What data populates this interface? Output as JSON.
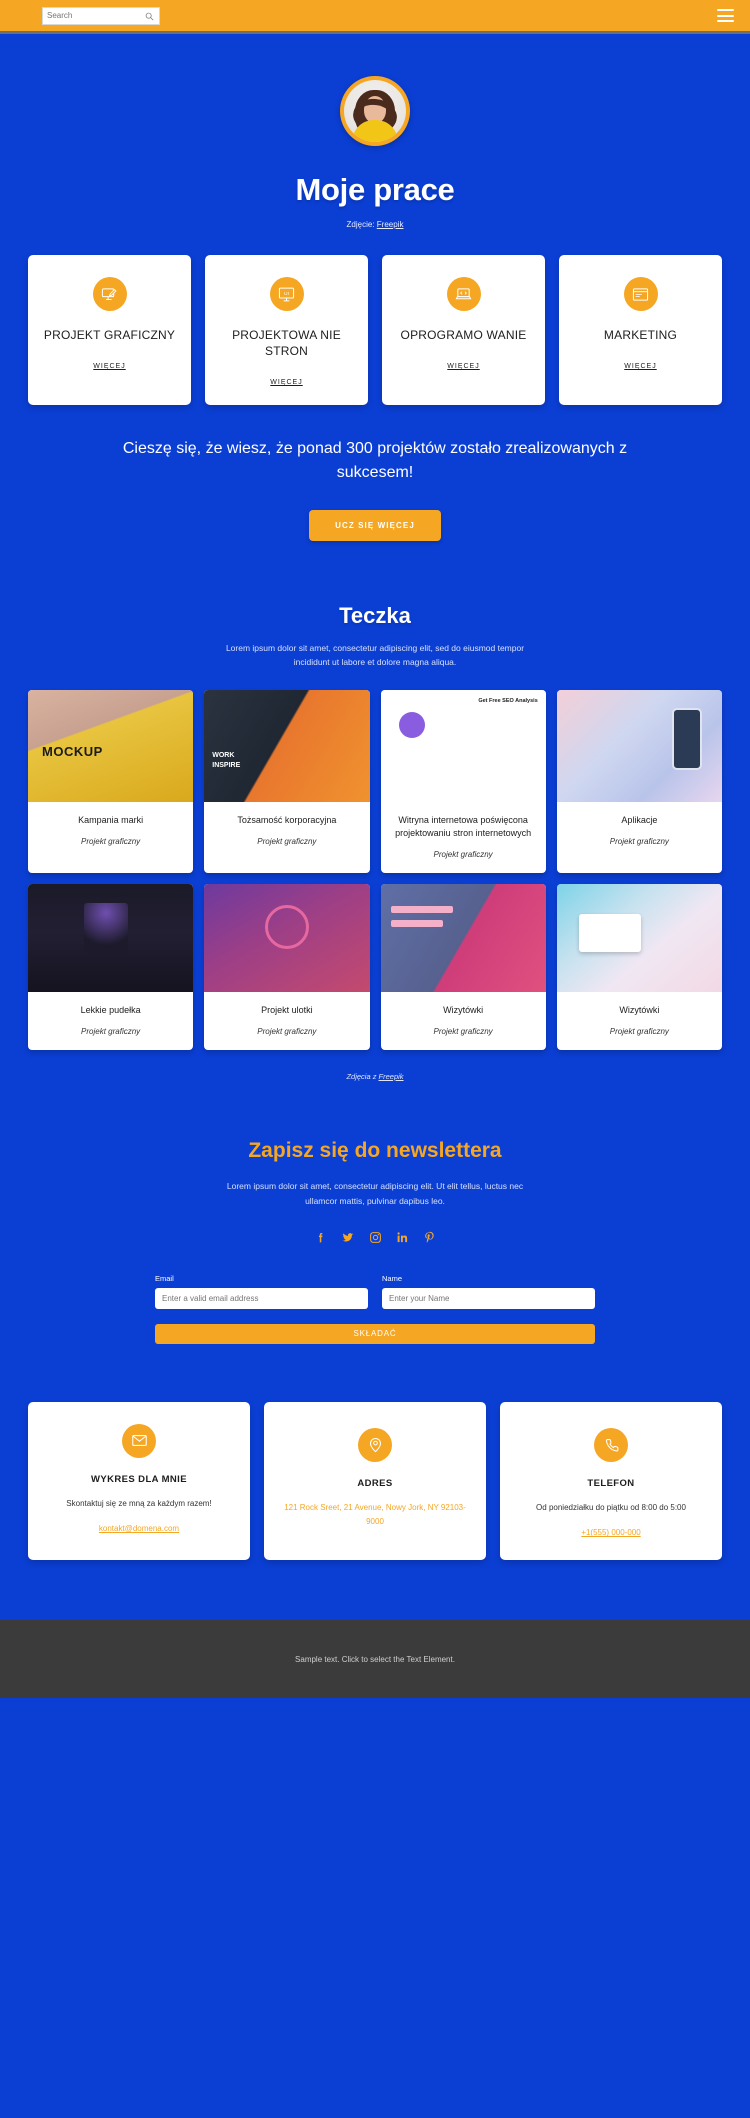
{
  "topbar": {
    "search_value": "",
    "search_placeholder": "Search",
    "search_icon": "search-icon",
    "menu_icon": "hamburger-menu-icon"
  },
  "hero": {
    "title": "Moje prace",
    "credit_prefix": "Zdjęcie: ",
    "credit_link": "Freepik",
    "avatar_alt": "portrait-photo"
  },
  "services": [
    {
      "icon": "design-tablet-brush-icon",
      "title": "PROJEKT GRAFICZNY",
      "more": "WIĘCEJ"
    },
    {
      "icon": "ui-monitor-icon",
      "title": "PROJEKTOWA NIE STRON",
      "more": "WIĘCEJ"
    },
    {
      "icon": "code-laptop-icon",
      "title": "OPROGRAMO WANIE",
      "more": "WIĘCEJ"
    },
    {
      "icon": "browser-window-icon",
      "title": "MARKETING",
      "more": "WIĘCEJ"
    }
  ],
  "promo": {
    "text": "Cieszę się, że wiesz, że ponad 300 projektów zostało zrealizowanych z sukcesem!",
    "button": "UCZ SIĘ WIĘCEJ"
  },
  "portfolio": {
    "title": "Teczka",
    "subtitle": "Lorem ipsum dolor sit amet, consectetur adipiscing elit, sed do eiusmod tempor incididunt ut labore et dolore magna aliqua.",
    "credit_prefix": "Zdjęcia z ",
    "credit_link": "Freepik",
    "items": [
      {
        "name": "Kampania marki",
        "category": "Projekt graficzny",
        "thumb": "mockup-yellow-package"
      },
      {
        "name": "Tożsamość korporacyjna",
        "category": "Projekt graficzny",
        "thumb": "dark-orange-brochure"
      },
      {
        "name": "Witryna internetowa poświęcona projektowaniu stron internetowych",
        "category": "Projekt graficzny",
        "thumb": "seo-landing-page"
      },
      {
        "name": "Aplikacje",
        "category": "Projekt graficzny",
        "thumb": "phone-mockups"
      },
      {
        "name": "Lekkie pudełka",
        "category": "Projekt graficzny",
        "thumb": "dark-lightbox-display"
      },
      {
        "name": "Projekt ulotki",
        "category": "Projekt graficzny",
        "thumb": "purple-dance-poster"
      },
      {
        "name": "Wizytówki",
        "category": "Projekt graficzny",
        "thumb": "pink-blue-cards"
      },
      {
        "name": "Wizytówki",
        "category": "Projekt graficzny",
        "thumb": "pastel-business-cards"
      }
    ]
  },
  "newsletter": {
    "title": "Zapisz się do newslettera",
    "subtitle": "Lorem ipsum dolor sit amet, consectetur adipiscing elit. Ut elit tellus, luctus nec ullamcor mattis, pulvinar dapibus leo.",
    "socials": [
      {
        "icon": "facebook-icon",
        "label": "Facebook"
      },
      {
        "icon": "twitter-icon",
        "label": "Twitter"
      },
      {
        "icon": "instagram-icon",
        "label": "Instagram"
      },
      {
        "icon": "linkedin-icon",
        "label": "LinkedIn"
      },
      {
        "icon": "pinterest-icon",
        "label": "Pinterest"
      }
    ],
    "email_label": "Email",
    "email_placeholder": "Enter a valid email address",
    "email_value": "",
    "name_label": "Name",
    "name_placeholder": "Enter your Name",
    "name_value": "",
    "submit": "SKŁADAĆ"
  },
  "contacts": [
    {
      "icon": "envelope-icon",
      "title": "WYKRES DLA MNIE",
      "text": "Skontaktuj się ze mną za każdym razem!",
      "link": "kontakt@domena.com"
    },
    {
      "icon": "map-pin-icon",
      "title": "ADRES",
      "address": "121 Rock Sreet, 21 Avenue, Nowy Jork, NY 92103-9000"
    },
    {
      "icon": "phone-icon",
      "title": "TELEFON",
      "text": "Od poniedziałku do piątku od 8:00 do 5:00",
      "link": "+1(555) 000-000"
    }
  ],
  "footer": {
    "text": "Sample text. Click to select the Text Element."
  },
  "colors": {
    "brand_blue": "#0B3FD4",
    "accent_orange": "#F5A623",
    "card_white": "#FFFFFF",
    "footer_gray": "#3B3B3B"
  }
}
